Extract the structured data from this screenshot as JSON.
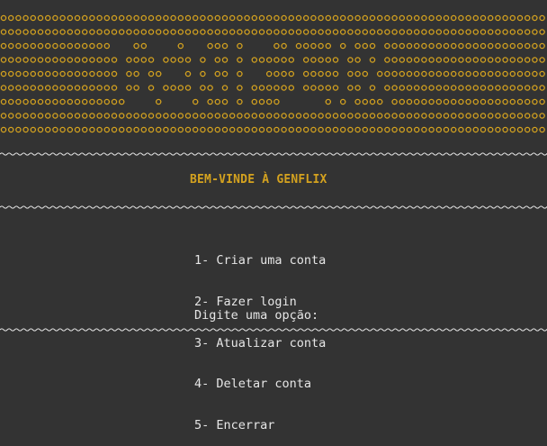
{
  "colors": {
    "background": "#333333",
    "accent": "#d4a21f",
    "text": "#e6e6e6"
  },
  "banner": {
    "rows": [
      "oooooooooooooooooooooooooooooooooooooooooooooooooooooooooooooooooooooooooo",
      "oooooooooooooooooooooooooooooooooooooooooooooooooooooooooooooooooooooooooo",
      "ooooooooooooooo   oo    o   ooo o    oo ooooo o ooo ooooooooooooooooooooooo",
      "oooooooooooooooo oooo oooo o oo o oooooo ooooo oo o oooooooooooooooooooooooo",
      "oooooooooooooooo oo oo   o o oo o   oooo ooooo ooo oooooooooooooooooooooooooo",
      "oooooooooooooooo oo o oooo oo o o oooooo ooooo oo o oooooooooooooooooooooooo",
      "ooooooooooooooooo    o    o ooo o oooo      o o oooo ooooooooooooooooooooooo",
      "oooooooooooooooooooooooooooooooooooooooooooooooooooooooooooooooooooooooooo",
      "oooooooooooooooooooooooooooooooooooooooooooooooooooooooooooooooooooooooooo"
    ]
  },
  "welcome": "BEM-VINDE À GENFLIX",
  "menu": {
    "items": [
      "1- Criar uma conta",
      "2- Fazer login",
      "3- Atualizar conta",
      "4- Deletar conta",
      "5- Encerrar"
    ],
    "prompt": "Digite uma opção:"
  }
}
